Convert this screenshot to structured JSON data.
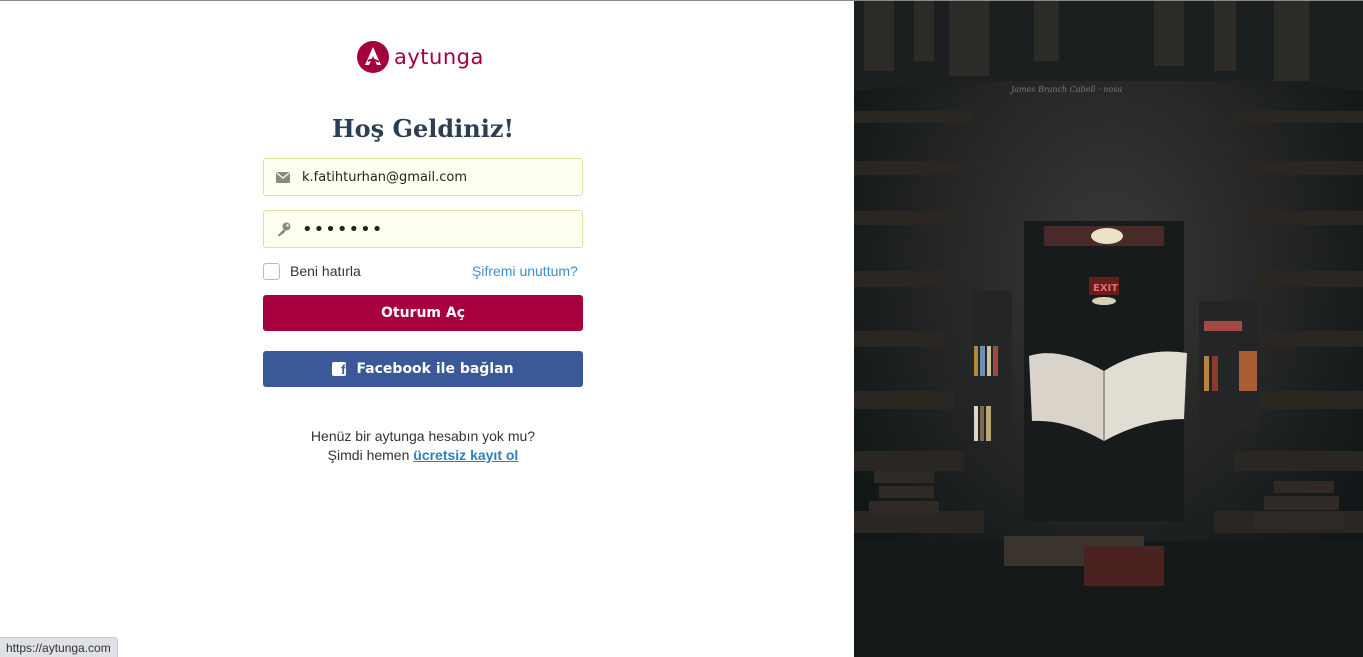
{
  "brand": {
    "name": "aytunga",
    "color": "#a3003f"
  },
  "welcome_title": "Hoş Geldiniz!",
  "form": {
    "email_value": "k.fatihturhan@gmail.com",
    "password_value": "•••••••",
    "remember_label": "Beni hatırla",
    "forgot_label": "Şifremi unuttum?",
    "login_button": "Oturum Aç",
    "facebook_button": "Facebook ile bağlan"
  },
  "signup": {
    "line1": "Henüz bir aytunga hesabın yok mu?",
    "line2_prefix": "Şimdi hemen ",
    "link": "ücretsiz kayıt ol"
  },
  "status_bar_url": "https://aytunga.com",
  "icons": {
    "email": "envelope-icon",
    "password": "key-icon",
    "facebook": "facebook-icon",
    "logo": "aytunga-logo-icon"
  },
  "colors": {
    "login_button": "#a7003f",
    "facebook_button": "#3b5998",
    "link": "#3d8fc9",
    "input_bg": "#fefff0"
  },
  "hero_image": {
    "label": "James Branch Cabell · nosa",
    "exit_sign": "EXIT"
  }
}
